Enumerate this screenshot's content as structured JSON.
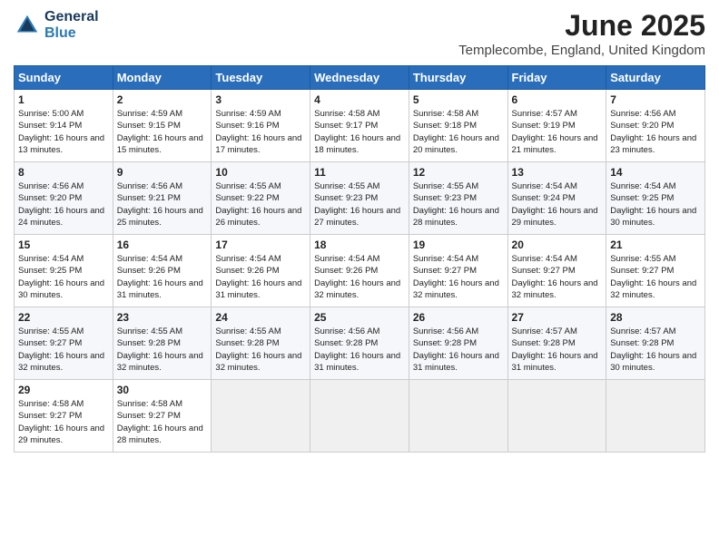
{
  "header": {
    "title": "June 2025",
    "location": "Templecombe, England, United Kingdom"
  },
  "columns": [
    "Sunday",
    "Monday",
    "Tuesday",
    "Wednesday",
    "Thursday",
    "Friday",
    "Saturday"
  ],
  "weeks": [
    [
      {
        "day": "1",
        "sunrise": "Sunrise: 5:00 AM",
        "sunset": "Sunset: 9:14 PM",
        "daylight": "Daylight: 16 hours and 13 minutes."
      },
      {
        "day": "2",
        "sunrise": "Sunrise: 4:59 AM",
        "sunset": "Sunset: 9:15 PM",
        "daylight": "Daylight: 16 hours and 15 minutes."
      },
      {
        "day": "3",
        "sunrise": "Sunrise: 4:59 AM",
        "sunset": "Sunset: 9:16 PM",
        "daylight": "Daylight: 16 hours and 17 minutes."
      },
      {
        "day": "4",
        "sunrise": "Sunrise: 4:58 AM",
        "sunset": "Sunset: 9:17 PM",
        "daylight": "Daylight: 16 hours and 18 minutes."
      },
      {
        "day": "5",
        "sunrise": "Sunrise: 4:58 AM",
        "sunset": "Sunset: 9:18 PM",
        "daylight": "Daylight: 16 hours and 20 minutes."
      },
      {
        "day": "6",
        "sunrise": "Sunrise: 4:57 AM",
        "sunset": "Sunset: 9:19 PM",
        "daylight": "Daylight: 16 hours and 21 minutes."
      },
      {
        "day": "7",
        "sunrise": "Sunrise: 4:56 AM",
        "sunset": "Sunset: 9:20 PM",
        "daylight": "Daylight: 16 hours and 23 minutes."
      }
    ],
    [
      {
        "day": "8",
        "sunrise": "Sunrise: 4:56 AM",
        "sunset": "Sunset: 9:20 PM",
        "daylight": "Daylight: 16 hours and 24 minutes."
      },
      {
        "day": "9",
        "sunrise": "Sunrise: 4:56 AM",
        "sunset": "Sunset: 9:21 PM",
        "daylight": "Daylight: 16 hours and 25 minutes."
      },
      {
        "day": "10",
        "sunrise": "Sunrise: 4:55 AM",
        "sunset": "Sunset: 9:22 PM",
        "daylight": "Daylight: 16 hours and 26 minutes."
      },
      {
        "day": "11",
        "sunrise": "Sunrise: 4:55 AM",
        "sunset": "Sunset: 9:23 PM",
        "daylight": "Daylight: 16 hours and 27 minutes."
      },
      {
        "day": "12",
        "sunrise": "Sunrise: 4:55 AM",
        "sunset": "Sunset: 9:23 PM",
        "daylight": "Daylight: 16 hours and 28 minutes."
      },
      {
        "day": "13",
        "sunrise": "Sunrise: 4:54 AM",
        "sunset": "Sunset: 9:24 PM",
        "daylight": "Daylight: 16 hours and 29 minutes."
      },
      {
        "day": "14",
        "sunrise": "Sunrise: 4:54 AM",
        "sunset": "Sunset: 9:25 PM",
        "daylight": "Daylight: 16 hours and 30 minutes."
      }
    ],
    [
      {
        "day": "15",
        "sunrise": "Sunrise: 4:54 AM",
        "sunset": "Sunset: 9:25 PM",
        "daylight": "Daylight: 16 hours and 30 minutes."
      },
      {
        "day": "16",
        "sunrise": "Sunrise: 4:54 AM",
        "sunset": "Sunset: 9:26 PM",
        "daylight": "Daylight: 16 hours and 31 minutes."
      },
      {
        "day": "17",
        "sunrise": "Sunrise: 4:54 AM",
        "sunset": "Sunset: 9:26 PM",
        "daylight": "Daylight: 16 hours and 31 minutes."
      },
      {
        "day": "18",
        "sunrise": "Sunrise: 4:54 AM",
        "sunset": "Sunset: 9:26 PM",
        "daylight": "Daylight: 16 hours and 32 minutes."
      },
      {
        "day": "19",
        "sunrise": "Sunrise: 4:54 AM",
        "sunset": "Sunset: 9:27 PM",
        "daylight": "Daylight: 16 hours and 32 minutes."
      },
      {
        "day": "20",
        "sunrise": "Sunrise: 4:54 AM",
        "sunset": "Sunset: 9:27 PM",
        "daylight": "Daylight: 16 hours and 32 minutes."
      },
      {
        "day": "21",
        "sunrise": "Sunrise: 4:55 AM",
        "sunset": "Sunset: 9:27 PM",
        "daylight": "Daylight: 16 hours and 32 minutes."
      }
    ],
    [
      {
        "day": "22",
        "sunrise": "Sunrise: 4:55 AM",
        "sunset": "Sunset: 9:27 PM",
        "daylight": "Daylight: 16 hours and 32 minutes."
      },
      {
        "day": "23",
        "sunrise": "Sunrise: 4:55 AM",
        "sunset": "Sunset: 9:28 PM",
        "daylight": "Daylight: 16 hours and 32 minutes."
      },
      {
        "day": "24",
        "sunrise": "Sunrise: 4:55 AM",
        "sunset": "Sunset: 9:28 PM",
        "daylight": "Daylight: 16 hours and 32 minutes."
      },
      {
        "day": "25",
        "sunrise": "Sunrise: 4:56 AM",
        "sunset": "Sunset: 9:28 PM",
        "daylight": "Daylight: 16 hours and 31 minutes."
      },
      {
        "day": "26",
        "sunrise": "Sunrise: 4:56 AM",
        "sunset": "Sunset: 9:28 PM",
        "daylight": "Daylight: 16 hours and 31 minutes."
      },
      {
        "day": "27",
        "sunrise": "Sunrise: 4:57 AM",
        "sunset": "Sunset: 9:28 PM",
        "daylight": "Daylight: 16 hours and 31 minutes."
      },
      {
        "day": "28",
        "sunrise": "Sunrise: 4:57 AM",
        "sunset": "Sunset: 9:28 PM",
        "daylight": "Daylight: 16 hours and 30 minutes."
      }
    ],
    [
      {
        "day": "29",
        "sunrise": "Sunrise: 4:58 AM",
        "sunset": "Sunset: 9:27 PM",
        "daylight": "Daylight: 16 hours and 29 minutes."
      },
      {
        "day": "30",
        "sunrise": "Sunrise: 4:58 AM",
        "sunset": "Sunset: 9:27 PM",
        "daylight": "Daylight: 16 hours and 28 minutes."
      },
      null,
      null,
      null,
      null,
      null
    ]
  ]
}
